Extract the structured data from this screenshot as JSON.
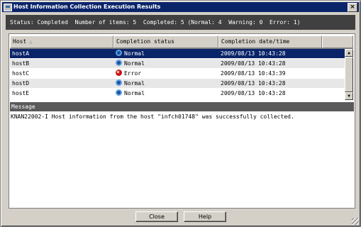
{
  "window": {
    "title": "Host Information Collection Execution Results",
    "close_glyph": "×"
  },
  "summary": {
    "text": "Status: Completed  Number of items: 5  Completed: 5 (Normal: 4  Warning: 0  Error: 1)"
  },
  "grid": {
    "columns": [
      {
        "label": "Host",
        "sort_icon": "sort-asc-icon"
      },
      {
        "label": "Completion status"
      },
      {
        "label": "Completion date/time"
      }
    ],
    "rows": [
      {
        "host": "hostA",
        "status": "Normal",
        "status_icon": "normal-status-icon",
        "datetime": "2009/08/13 10:43:28",
        "selected": true
      },
      {
        "host": "hostB",
        "status": "Normal",
        "status_icon": "normal-status-icon",
        "datetime": "2009/08/13 10:43:28"
      },
      {
        "host": "hostC",
        "status": "Error",
        "status_icon": "error-status-icon",
        "datetime": "2009/08/13 10:43:39"
      },
      {
        "host": "hostD",
        "status": "Normal",
        "status_icon": "normal-status-icon",
        "datetime": "2009/08/13 10:43:28"
      },
      {
        "host": "hostE",
        "status": "Normal",
        "status_icon": "normal-status-icon",
        "datetime": "2009/08/13 10:43:28"
      }
    ]
  },
  "message": {
    "header": "Message",
    "text": "KNAN22002-I Host information from the host \"infch01748\" was successfully collected."
  },
  "buttons": {
    "close": "Close",
    "help": "Help"
  },
  "colors": {
    "title_bar": "#0a246a",
    "selection": "#0a246a",
    "status_bar": "#404040",
    "message_header": "#5a5a5a",
    "error": "#c81010",
    "normal": "#1d4fa0"
  }
}
